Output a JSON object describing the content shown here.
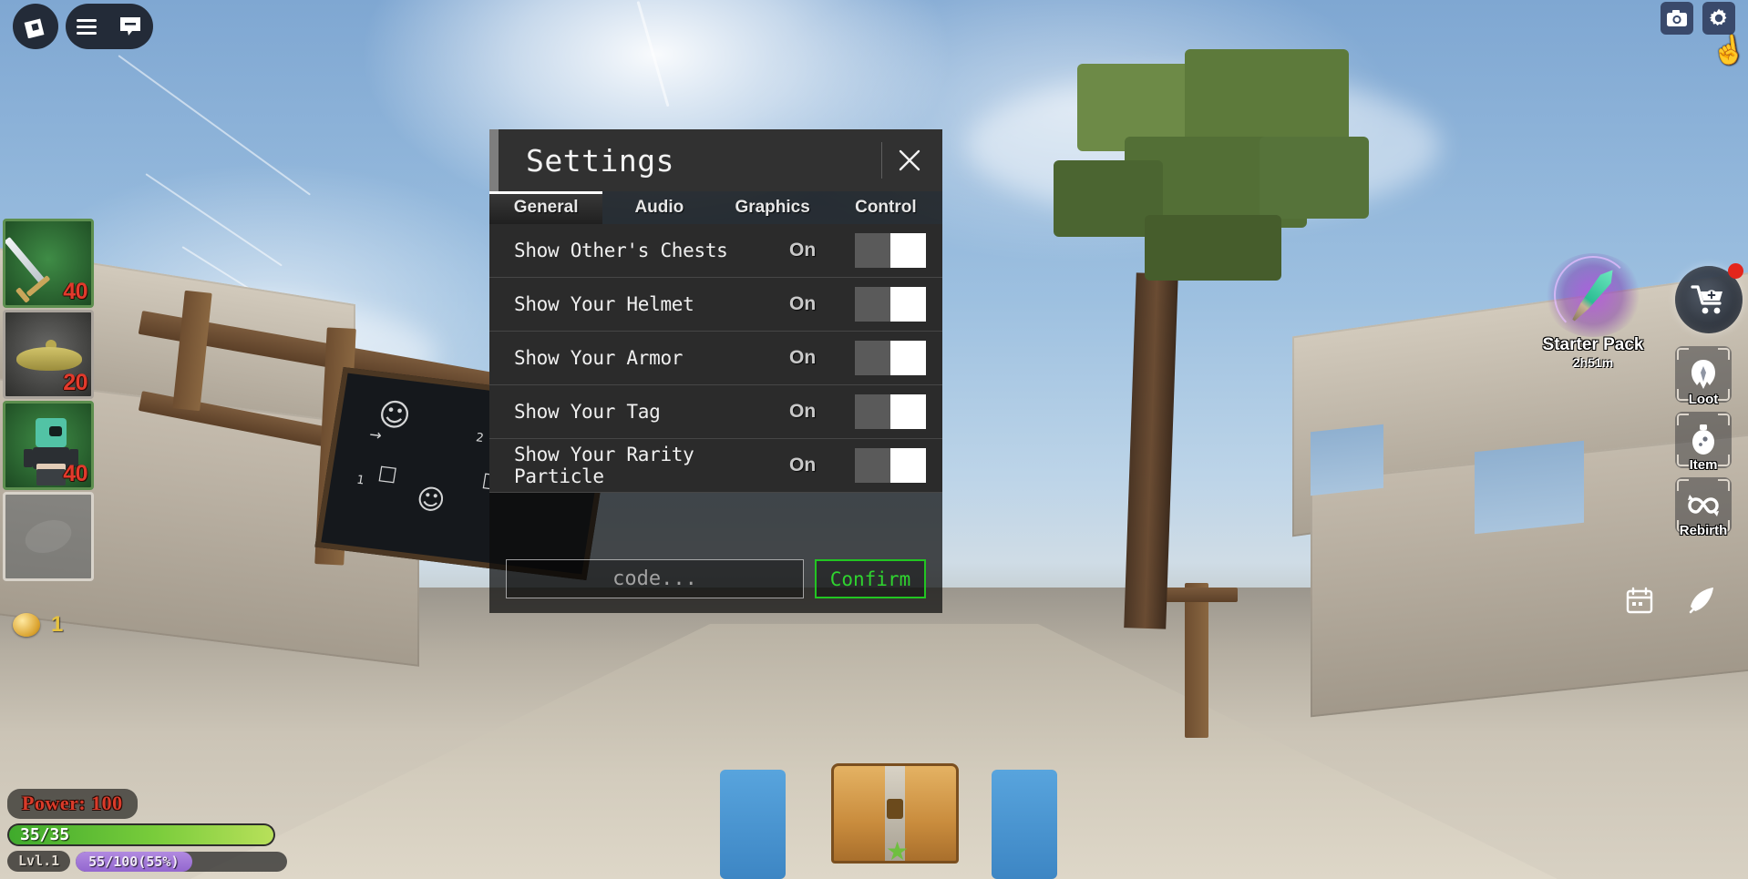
{
  "window": {
    "title": "Settings"
  },
  "topleft": {
    "logo_icon": "roblox-logo-icon",
    "menu_icon": "hamburger-menu-icon",
    "chat_icon": "chat-bubble-icon"
  },
  "topright": {
    "screenshot_icon": "camera-icon",
    "settings_icon": "gear-icon",
    "cursor_icon": "pointer-hand-cursor"
  },
  "inventory": {
    "slots": [
      {
        "name": "sword",
        "qty": "40",
        "rarity": "rare"
      },
      {
        "name": "hat",
        "qty": "20",
        "rarity": "common"
      },
      {
        "name": "armor",
        "qty": "40",
        "rarity": "rare"
      },
      {
        "name": "empty",
        "qty": "",
        "rarity": "empty"
      }
    ]
  },
  "currency": {
    "coin_icon": "gold-coin-icon",
    "amount": "1"
  },
  "stats": {
    "power_label": "Power: 100",
    "health": "35/35",
    "level": "Lvl.1",
    "xp": "55/100(55%)",
    "xp_percent": 55,
    "health_color": "#79cc3b",
    "xp_color": "#9367cf",
    "power_color": "#d93b2a"
  },
  "starter_pack": {
    "name": "Starter Pack",
    "timer": "2h51m",
    "icon": "glowing-sword-icon"
  },
  "shop": {
    "icon": "shopping-cart-icon",
    "badge": "",
    "badge_color": "#e3261c"
  },
  "side_buttons": [
    {
      "label": "Loot",
      "icon": "helmet-icon"
    },
    {
      "label": "Item",
      "icon": "potion-icon"
    },
    {
      "label": "Rebirth",
      "icon": "infinity-arrows-icon"
    }
  ],
  "mini_buttons": [
    {
      "icon": "calendar-icon"
    },
    {
      "icon": "feather-quill-icon"
    }
  ],
  "settings": {
    "close_icon": "close-x-icon",
    "tabs": [
      {
        "label": "General",
        "active": true
      },
      {
        "label": "Audio",
        "active": false
      },
      {
        "label": "Graphics",
        "active": false
      },
      {
        "label": "Control",
        "active": false
      }
    ],
    "rows": [
      {
        "label": "Show Other's Chests",
        "state": "On",
        "enabled": true
      },
      {
        "label": "Show Your Helmet",
        "state": "On",
        "enabled": true
      },
      {
        "label": "Show Your Armor",
        "state": "On",
        "enabled": true
      },
      {
        "label": "Show Your Tag",
        "state": "On",
        "enabled": true
      },
      {
        "label": "Show Your Rarity Particle",
        "state": "On",
        "enabled": true
      }
    ],
    "code": {
      "value": "",
      "placeholder": "code...",
      "confirm_label": "Confirm",
      "confirm_color": "#22c522"
    }
  },
  "chalkboard": {
    "marks": [
      "1",
      "2"
    ]
  }
}
